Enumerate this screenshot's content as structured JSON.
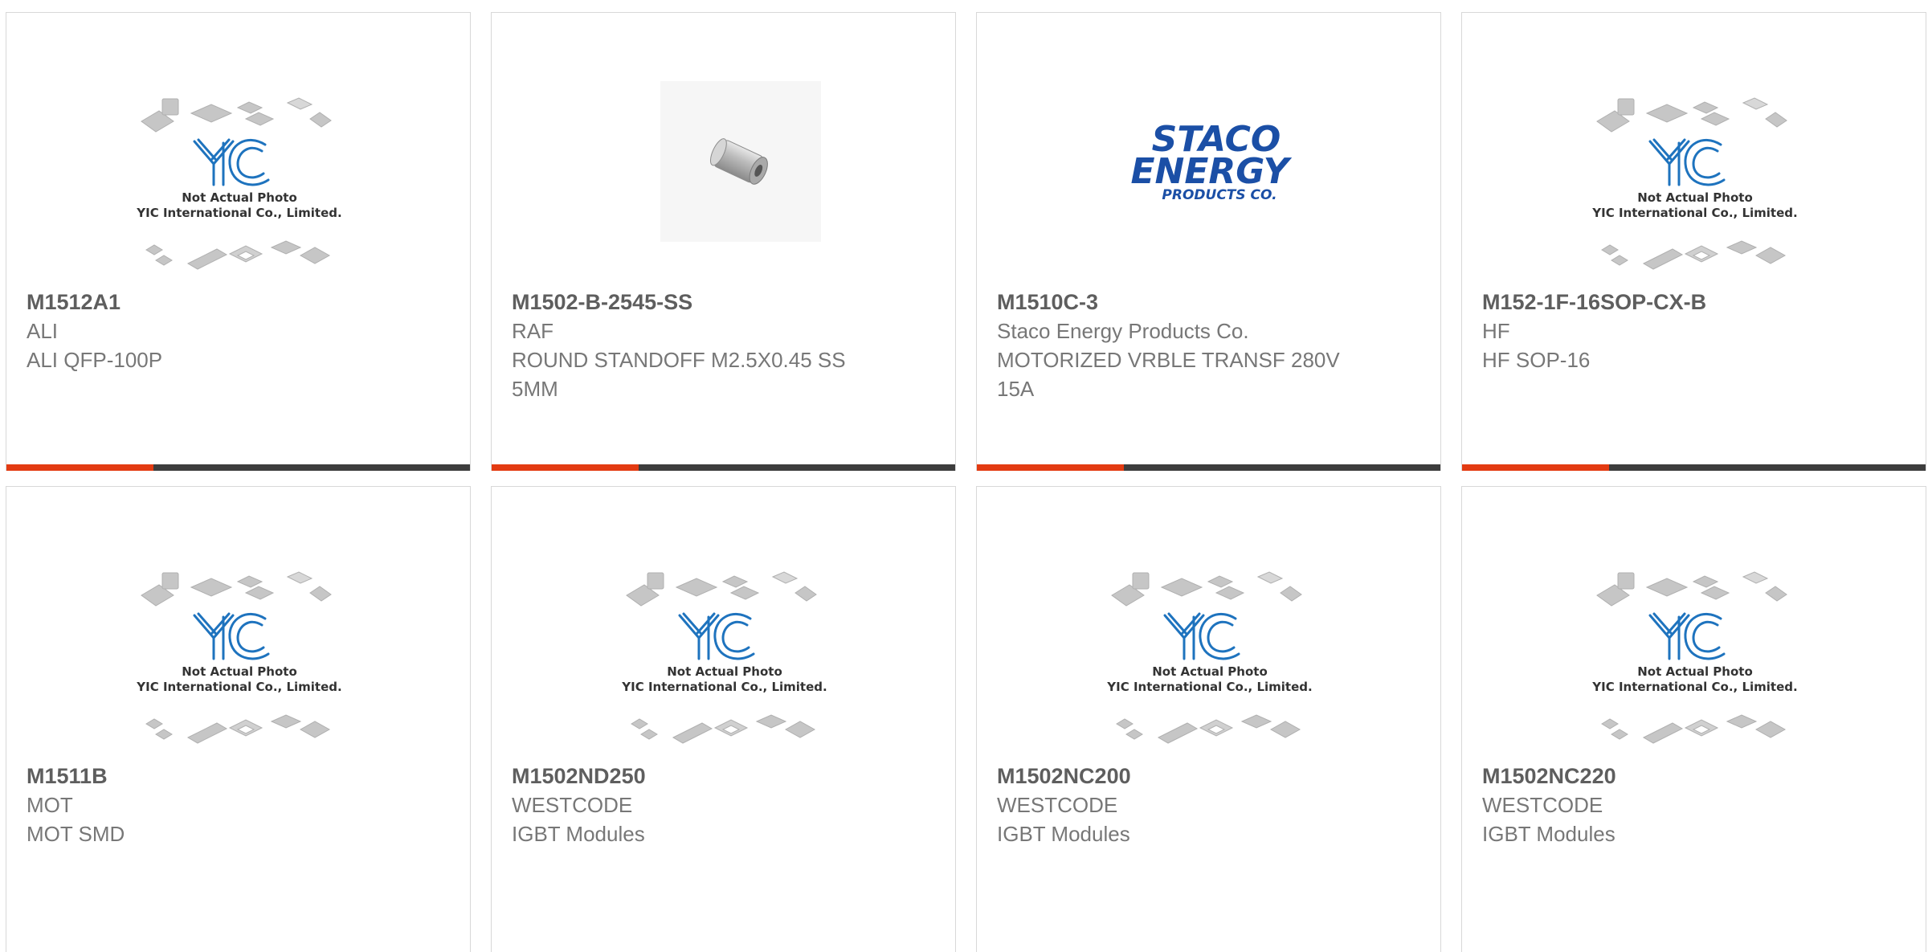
{
  "placeholder": {
    "brand": "YIC",
    "line1": "Not Actual Photo",
    "line2": "YIC International Co., Limited."
  },
  "staco_logo": {
    "line1": "STACO",
    "line2": "ENERGY",
    "line3": "PRODUCTS CO."
  },
  "colors": {
    "accent": "#e33b12",
    "bar": "#3d3d3d",
    "logo_blue": "#1b4fa6",
    "yic_blue": "#1e73be"
  },
  "products": [
    {
      "part": "M1512A1",
      "mfr": "ALI",
      "desc": "ALI QFP-100P"
    },
    {
      "part": "M1502-B-2545-SS",
      "mfr": "RAF",
      "desc": "ROUND STANDOFF M2.5X0.45 SS 5MM"
    },
    {
      "part": "M1510C-3",
      "mfr": "Staco Energy Products Co.",
      "desc": "MOTORIZED VRBLE TRANSF 280V 15A"
    },
    {
      "part": "M152-1F-16SOP-CX-B",
      "mfr": "HF",
      "desc": "HF SOP-16"
    },
    {
      "part": "M1511B",
      "mfr": "MOT",
      "desc": "MOT SMD"
    },
    {
      "part": "M1502ND250",
      "mfr": "WESTCODE",
      "desc": "IGBT Modules"
    },
    {
      "part": "M1502NC200",
      "mfr": "WESTCODE",
      "desc": "IGBT Modules"
    },
    {
      "part": "M1502NC220",
      "mfr": "WESTCODE",
      "desc": "IGBT Modules"
    }
  ]
}
